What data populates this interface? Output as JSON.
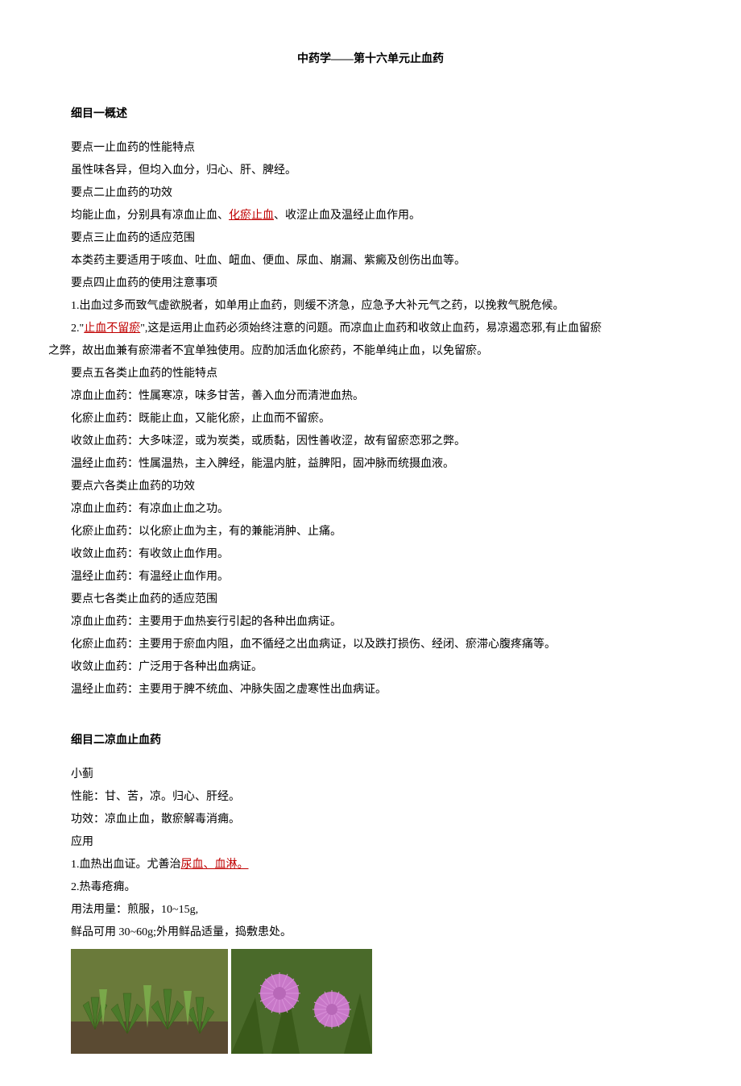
{
  "title": "中药学——第十六单元止血药",
  "section1": {
    "heading": "细目一概述",
    "p1_label": "要点一止血药的性能特点",
    "p1_body": "虽性味各异，但均入血分，归心、肝、脾经。",
    "p2_label": "要点二止血药的功效",
    "p2_body_a": "均能止血，分别具有凉血止血、",
    "p2_red": "化瘀止血",
    "p2_body_b": "、收涩止血及温经止血作用。",
    "p3_label": "要点三止血药的适应范围",
    "p3_body": "本类药主要适用于咳血、吐血、衄血、便血、尿血、崩漏、紫癜及创伤出血等。",
    "p4_label": "要点四止血药的使用注意事项",
    "p4_body1": "1.出血过多而致气虚欲脱者，如单用止血药，则缓不济急，应急予大补元气之药，以挽救气脱危候。",
    "p4_body2_a": "2.\"",
    "p4_body2_red": "止血不留瘀",
    "p4_body2_b": "\",这是运用止血药必须始终注意的问题。而凉血止血药和收敛止血药，易凉遏恋邪,有止血留瘀",
    "p4_body2_c": "之弊，故出血兼有瘀滞者不宜单独使用。应酌加活血化瘀药，不能单纯止血，以免留瘀。",
    "p5_label": "要点五各类止血药的性能特点",
    "p5_body1": "凉血止血药：性属寒凉，味多甘苦，善入血分而清泄血热。",
    "p5_body2": "化瘀止血药：既能止血，又能化瘀，止血而不留瘀。",
    "p5_body3": "收敛止血药：大多味涩，或为炭类，或质黏，因性善收涩，故有留瘀恋邪之弊。",
    "p5_body4": "温经止血药：性属温热，主入脾经，能温内脏，益脾阳，固冲脉而统摄血液。",
    "p6_label": "要点六各类止血药的功效",
    "p6_body1": "凉血止血药：有凉血止血之功。",
    "p6_body2": "化瘀止血药：以化瘀止血为主，有的兼能消肿、止痛。",
    "p6_body3": "收敛止血药：有收敛止血作用。",
    "p6_body4": "温经止血药：有温经止血作用。",
    "p7_label": "要点七各类止血药的适应范围",
    "p7_body1": "凉血止血药：主要用于血热妄行引起的各种出血病证。",
    "p7_body2": "化瘀止血药：主要用于瘀血内阻，血不循经之出血病证，以及跌打损伤、经闭、瘀滞心腹疼痛等。",
    "p7_body3": "收敛止血药：广泛用于各种出血病证。",
    "p7_body4": "温经止血药：主要用于脾不统血、冲脉失固之虚寒性出血病证。"
  },
  "section2": {
    "heading": "细目二凉血止血药",
    "herb_name": "小蓟",
    "prop_line": "性能：甘、苦，凉。归心、肝经。",
    "func_line": "功效：凉血止血，散瘀解毒消痈。",
    "app_label": "应用",
    "app1_a": "1.血热出血证。尤善治",
    "app1_red": "尿血、血淋。",
    "app2": "2.热毒疮痈。",
    "usage": "用法用量：煎服，10~15g,",
    "usage2": "鲜品可用 30~60g;外用鲜品适量，捣敷患处。"
  }
}
